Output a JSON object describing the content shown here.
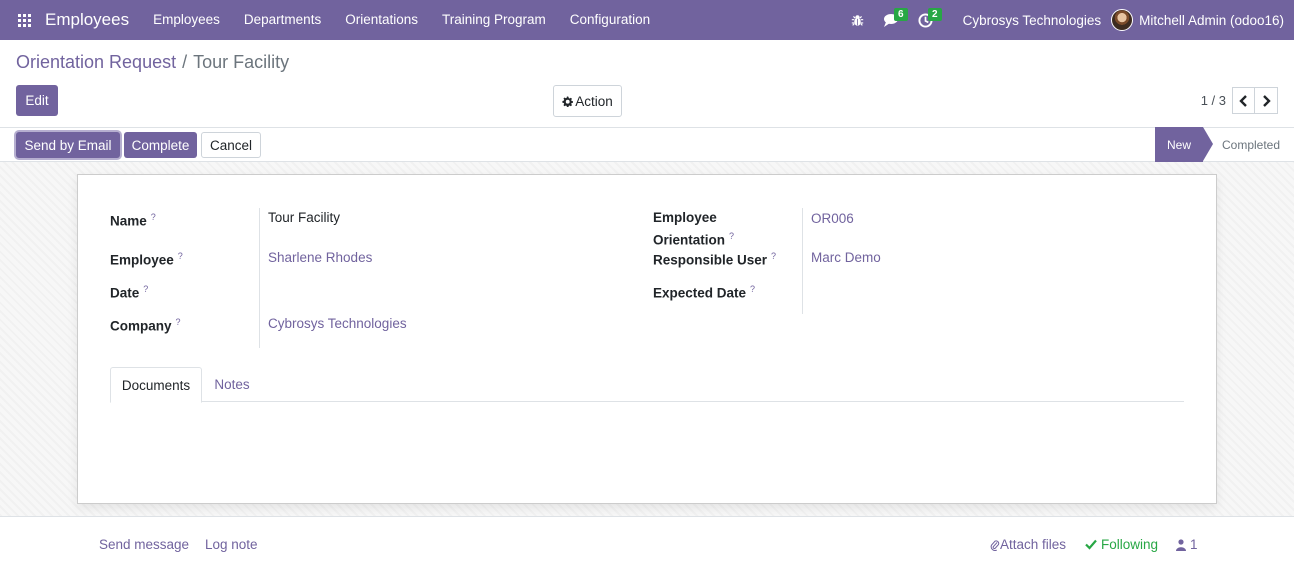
{
  "navbar": {
    "app_title": "Employees",
    "menu": [
      "Employees",
      "Departments",
      "Orientations",
      "Training Program",
      "Configuration"
    ],
    "messages_count": "6",
    "activities_count": "2",
    "company": "Cybrosys Technologies",
    "user": "Mitchell Admin (odoo16)"
  },
  "breadcrumb": {
    "parent": "Orientation Request",
    "separator": "/",
    "current": "Tour Facility"
  },
  "control": {
    "edit_label": "Edit",
    "action_label": "Action",
    "pager_value": "1 / 3"
  },
  "statusbar": {
    "buttons": [
      "Send by Email",
      "Complete",
      "Cancel"
    ],
    "stages": [
      "New",
      "Completed"
    ],
    "active_stage": "New"
  },
  "form": {
    "left_fields": [
      {
        "label": "Name",
        "value": "Tour Facility"
      },
      {
        "label": "Employee",
        "value": "Sharlene Rhodes"
      },
      {
        "label": "Date",
        "value": ""
      },
      {
        "label": "Company",
        "value": "Cybrosys Technologies"
      }
    ],
    "right_fields": [
      {
        "label_line1": "Employee",
        "label_line2": "Orientation",
        "value": "OR006"
      },
      {
        "label": "Responsible User",
        "value": "Marc Demo"
      },
      {
        "label": "Expected Date",
        "value": ""
      }
    ],
    "help_mark": "?",
    "tabs": [
      "Documents",
      "Notes"
    ],
    "active_tab": "Documents"
  },
  "chatter": {
    "send_message": "Send message",
    "log_note": "Log note",
    "attach_files": "Attach files",
    "following": "Following",
    "followers_count": "1"
  },
  "colors": {
    "brand": "#71639e",
    "success": "#28a745"
  }
}
